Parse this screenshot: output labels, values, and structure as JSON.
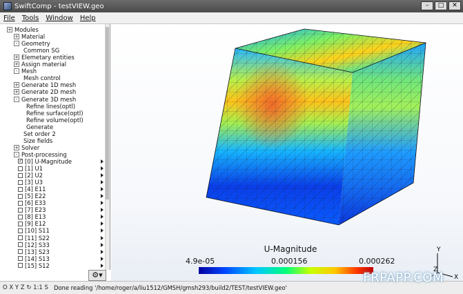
{
  "window": {
    "title": "SwiftComp - testVIEW.geo",
    "controls": [
      "–",
      "□",
      "✕"
    ]
  },
  "menu": [
    "File",
    "Tools",
    "Window",
    "Help"
  ],
  "tree": [
    {
      "label": "Modules",
      "expander": "+"
    },
    {
      "label": "Material",
      "expander": "+"
    },
    {
      "label": "Geometry",
      "expander": "-"
    },
    {
      "label": "Common SG"
    },
    {
      "label": "Elemetary entities",
      "expander": "+"
    },
    {
      "label": "Assign material",
      "expander": "+"
    },
    {
      "label": "Mesh",
      "expander": "-"
    },
    {
      "label": "Mesh control"
    },
    {
      "label": "Generate 1D mesh",
      "expander": "+"
    },
    {
      "label": "Generate 2D mesh",
      "expander": "+"
    },
    {
      "label": "Generate 3D mesh",
      "expander": "-"
    },
    {
      "label": "Refine lines(optl)"
    },
    {
      "label": "Refine surface(optl)"
    },
    {
      "label": "Refine volume(optl)"
    },
    {
      "label": "Generate"
    },
    {
      "label": "Set order 2"
    },
    {
      "label": "Size fields"
    },
    {
      "label": "Solver",
      "expander": "+"
    },
    {
      "label": "Post-processing",
      "expander": "-"
    },
    {
      "label": "[0] U-Magnitude",
      "checked": true
    },
    {
      "label": "[1] U1"
    },
    {
      "label": "[2] U2"
    },
    {
      "label": "[3] U3"
    },
    {
      "label": "[4] E11"
    },
    {
      "label": "[5] E22"
    },
    {
      "label": "[6] E33"
    },
    {
      "label": "[7] E23"
    },
    {
      "label": "[8] E13"
    },
    {
      "label": "[9] E12"
    },
    {
      "label": "[10] S11"
    },
    {
      "label": "[11] S22"
    },
    {
      "label": "[12] S33"
    },
    {
      "label": "[13] S23"
    },
    {
      "label": "[14] S13"
    },
    {
      "label": "[15] S12"
    }
  ],
  "gear_label": "⚙▾",
  "legend": {
    "title": "U-Magnitude",
    "min": "4.9e-05",
    "mid": "0.000156",
    "max": "0.000262"
  },
  "axes": {
    "x": "X",
    "y": "Y",
    "z": "Z"
  },
  "statusbar": {
    "view_buttons": "O X Y Z ↻ 1:1 S",
    "message": "Done reading '/home/roger/a/liu1512/GMSH/gmsh293/build2/TEST/testVIEW.geo'"
  },
  "watermark": "FRPAPP.COM",
  "colors": {
    "accent": "#0046ff",
    "hot": "#c00000"
  }
}
